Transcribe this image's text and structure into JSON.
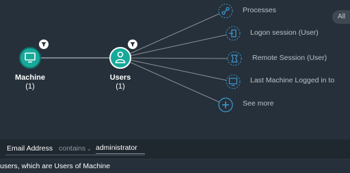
{
  "nodes": {
    "machine": {
      "label": "Machine",
      "count": "(1)"
    },
    "users": {
      "label": "Users",
      "count": "(1)"
    }
  },
  "branches": [
    {
      "label": "Processes",
      "icon": "process-icon"
    },
    {
      "label": "Logon session (User)",
      "icon": "login-icon"
    },
    {
      "label": "Remote Session (User)",
      "icon": "remote-session-icon"
    },
    {
      "label": "Last Machine Logged in to",
      "icon": "monitor-icon"
    },
    {
      "label": "See more",
      "icon": "plus-icon"
    }
  ],
  "pill_label": "All",
  "filter": {
    "field": "Email Address",
    "operator": "contains",
    "value": "administrator"
  },
  "description": "users, which are Users of Machine",
  "colors": {
    "background": "#26303a",
    "node_fill": "#17a99a",
    "edge": "#9aa3ab",
    "branch_ring": "#3d9dd8"
  }
}
